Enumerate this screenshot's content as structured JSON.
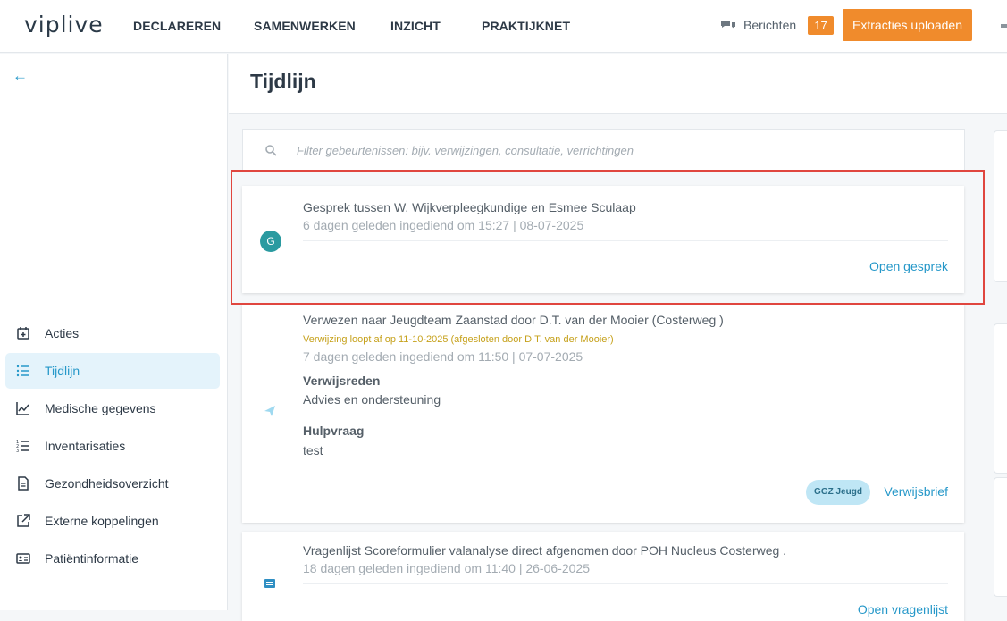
{
  "header": {
    "logo": "viplive",
    "nav": [
      "DECLAREREN",
      "SAMENWERKEN",
      "INZICHT",
      "PRAKTIJKNET"
    ],
    "messages_label": "Berichten",
    "messages_count": "17",
    "upload_label": "Extracties uploaden"
  },
  "sidebar": {
    "items": [
      {
        "label": "Acties",
        "icon": "calendar-plus-icon"
      },
      {
        "label": "Tijdlijn",
        "icon": "list-icon",
        "active": true
      },
      {
        "label": "Medische gegevens",
        "icon": "chart-line-icon"
      },
      {
        "label": "Inventarisaties",
        "icon": "ordered-list-icon"
      },
      {
        "label": "Gezondheidsoverzicht",
        "icon": "document-icon"
      },
      {
        "label": "Externe koppelingen",
        "icon": "external-link-icon"
      },
      {
        "label": "Patiëntinformatie",
        "icon": "id-card-icon"
      }
    ]
  },
  "main": {
    "title": "Tijdlijn",
    "search_placeholder": "Filter gebeurtenissen: bijv. verwijzingen, consultatie, verrichtingen",
    "events": [
      {
        "avatar": "G",
        "title": "Gesprek tussen W. Wijkverpleegkundige en Esmee Sculaap",
        "meta": "6 dagen geleden ingediend om 15:27 | 08-07-2025",
        "link": "Open gesprek"
      },
      {
        "title": "Verwezen naar Jeugdteam Zaanstad door D.T. van der Mooier (Costerweg )",
        "warning": "Verwijzing loopt af op 11-10-2025 (afgesloten door D.T. van der Mooier)",
        "meta": "7 dagen geleden ingediend om 11:50 | 07-07-2025",
        "reason_label": "Verwijsreden",
        "reason_value": "Advies en ondersteuning",
        "help_label": "Hulpvraag",
        "help_value": "test",
        "tag": "GGZ Jeugd",
        "link": "Verwijsbrief"
      },
      {
        "title": "Vragenlijst Scoreformulier valanalyse direct afgenomen door POH Nucleus Costerweg .",
        "meta": "18 dagen geleden ingediend om 11:40 | 26-06-2025",
        "link": "Open vragenlijst"
      }
    ]
  },
  "colors": {
    "accent": "#2698c9",
    "orange": "#f08b2c",
    "highlight": "#e0463f"
  }
}
